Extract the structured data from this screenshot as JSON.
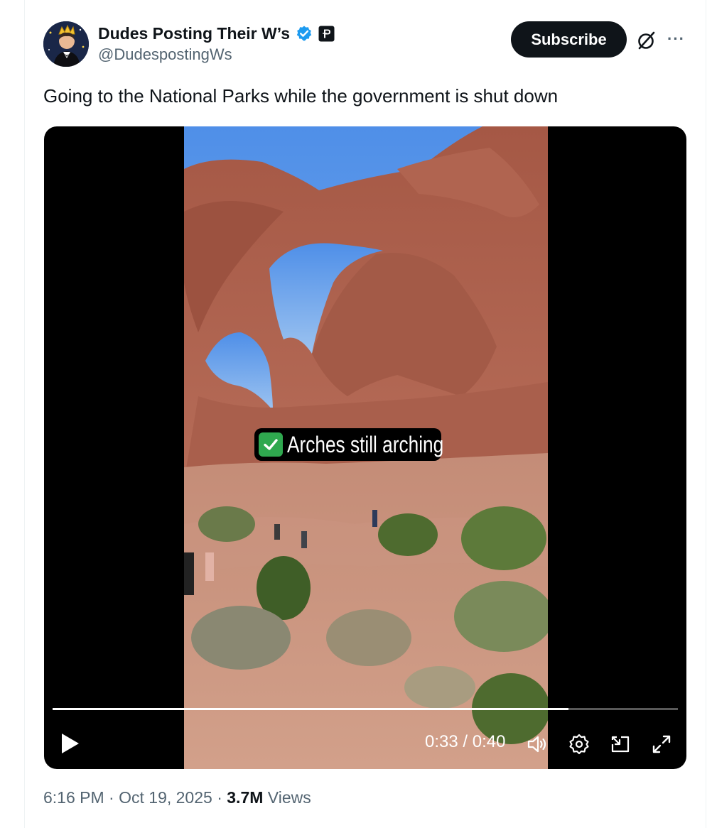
{
  "author": {
    "display_name": "Dudes Posting Their W’s",
    "handle": "@DudespostingWs",
    "verified_icon": "verified-badge-icon",
    "affiliate_icon": "affiliate-p-icon"
  },
  "actions": {
    "subscribe_label": "Subscribe",
    "grok_icon": "grok-icon",
    "more_icon": "more-icon",
    "more_glyph": "···"
  },
  "tweet": {
    "text": "Going to the National Parks while the government is shut down"
  },
  "video": {
    "caption_text": "Arches still arching",
    "caption_icon": "check-mark-icon",
    "progress": 0.825,
    "current_time": "0:33",
    "duration": "0:40",
    "time_display": "0:33 / 0:40",
    "controls": [
      "play-icon",
      "volume-icon",
      "settings-icon",
      "picture-in-picture-icon",
      "fullscreen-icon"
    ]
  },
  "meta": {
    "time": "6:16 PM",
    "date": "Oct 19, 2025",
    "views_count": "3.7M",
    "views_label": "Views",
    "separator": "·"
  },
  "colors": {
    "text_primary": "#0f1419",
    "text_secondary": "#536471",
    "verified": "#1d9bf0",
    "sky": "#5b9be6",
    "rock": "#b0624f"
  }
}
